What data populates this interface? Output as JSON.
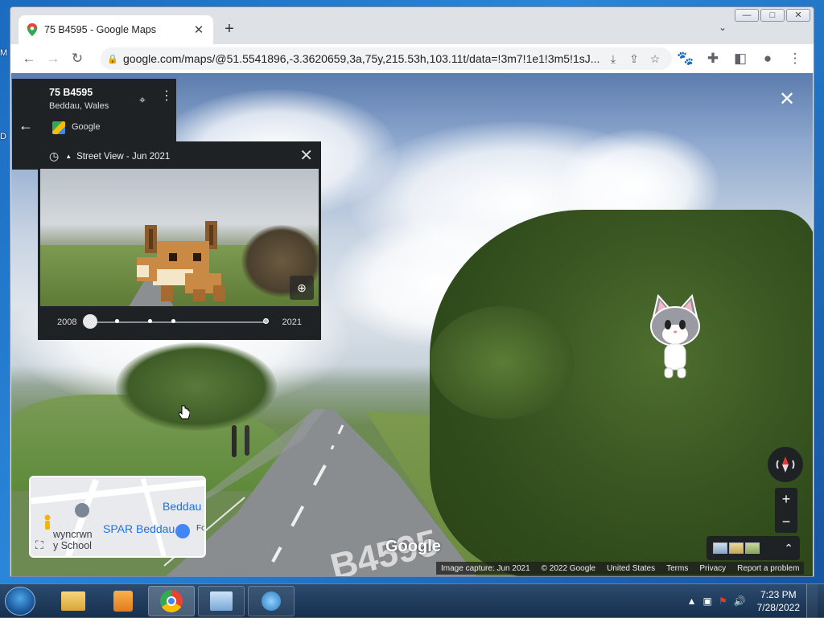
{
  "browser": {
    "tab_title": "75 B4595 - Google Maps",
    "url": "google.com/maps/@51.5541896,-3.3620659,3a,75y,215.53h,103.11t/data=!3m7!1e1!3m5!1sJ..."
  },
  "panel": {
    "address": "75 B4595",
    "locality": "Beddau, Wales",
    "source": "Google"
  },
  "timeline": {
    "title": "Street View - Jun 2021",
    "start_year": "2008",
    "end_year": "2021",
    "selected_position": 0
  },
  "minimap": {
    "label_beddau": "Beddau S",
    "label_spar": "SPAR Beddau",
    "label_school": "wyncrwn\ny School",
    "fo": "Fo"
  },
  "streetview": {
    "road_marking": "B4595",
    "brand": "Google"
  },
  "footer": {
    "capture": "Image capture: Jun 2021",
    "copyright": "© 2022 Google",
    "country": "United States",
    "terms": "Terms",
    "privacy": "Privacy",
    "report": "Report a problem"
  },
  "clock": {
    "time": "7:23 PM",
    "date": "7/28/2022"
  },
  "icons": {
    "tab_favicon": "maps-pin-icon",
    "compass": "compass-icon"
  }
}
